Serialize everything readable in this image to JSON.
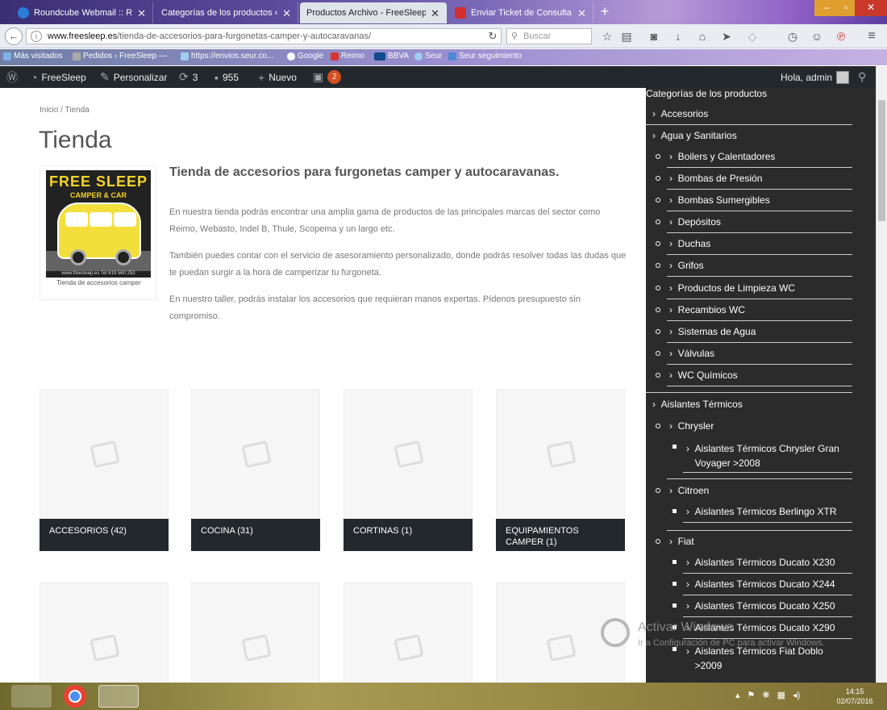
{
  "browser": {
    "tabs": [
      {
        "label": "Roundcube Webmail :: Re...",
        "active": false,
        "icon": "roundcube-icon"
      },
      {
        "label": "Categorías de los productos ‹ ...",
        "active": false,
        "icon": "none"
      },
      {
        "label": "Productos Archivo - FreeSleep",
        "active": true,
        "icon": "none"
      },
      {
        "label": "Enviar Ticket de Consulta ...",
        "active": false,
        "icon": "ticket-icon"
      }
    ],
    "url_host": "www.freesleep.es",
    "url_path": "/tienda-de-accesorios-para-furgonetas-camper-y-autocaravanas/",
    "search_placeholder": "Buscar",
    "bookmarks": [
      "Más visitados",
      "Pedidos ‹ FreeSleep —",
      "https://envios.seur.co...",
      "Google",
      "Reimo",
      "BBVA",
      "Seur",
      "Seur seguimiento"
    ]
  },
  "adminbar": {
    "site_name": "FreeSleep",
    "customize": "Personalizar",
    "updates": "3",
    "comments": "955",
    "new": "Nuevo",
    "plugin_badge": "2",
    "greeting": "Hola, admin"
  },
  "page": {
    "breadcrumb": "Inicio / Tienda",
    "title": "Tienda",
    "logo_text_1": "FREE SLEEP",
    "logo_text_2": "CAMPER & CAR",
    "logo_text_3": "www.freesleep.es     Tel 619 560 253",
    "image_caption": "Tienda de accesorios camper",
    "desc_title": "Tienda de accesorios para furgonetas camper y autocaravanas.",
    "desc_p1": "En nuestra tienda podrás encontrar una amplia gama de productos de las principales marcas del sector como Reimo, Webasto, Indel B, Thule, Scopema y un largo etc.",
    "desc_p2": "También puedes contar con el servicio de asesoramiento personalizado, donde podrás resolver todas las dudas que te puedan surgir a la hora de camperizar tu furgoneta.",
    "desc_p3": "En nuestro taller, podrás instalar los accesorios que requieran manos expertas. Pídenos presupuesto sin compromiso."
  },
  "products": [
    {
      "label": "ACCESORIOS (42)"
    },
    {
      "label": "COCINA (31)"
    },
    {
      "label": "CORTINAS (1)"
    },
    {
      "label": "EQUIPAMIENTOS CAMPER (1)"
    }
  ],
  "sidebar": {
    "title": "Categorías de los productos",
    "items": [
      {
        "label": "Accesorios"
      },
      {
        "label": "Agua y Sanitarios"
      },
      {
        "label": "Boilers y Calentadores"
      },
      {
        "label": "Bombas de Presión"
      },
      {
        "label": "Bombas Sumergibles"
      },
      {
        "label": "Depósitos"
      },
      {
        "label": "Duchas"
      },
      {
        "label": "Grifos"
      },
      {
        "label": "Productos de Limpieza WC"
      },
      {
        "label": "Recambios WC"
      },
      {
        "label": "Sistemas de Agua"
      },
      {
        "label": "Válvulas"
      },
      {
        "label": "WC Químicos"
      },
      {
        "label": "Aislantes Térmicos"
      },
      {
        "label": "Chrysler"
      },
      {
        "label": "Aislantes Térmicos Chrysler Gran Voyager >2008"
      },
      {
        "label": "Citroen"
      },
      {
        "label": "Aislantes Térmicos Berlingo XTR"
      },
      {
        "label": "Fiat"
      },
      {
        "label": "Aislantes Térmicos Ducato X230"
      },
      {
        "label": "Aislantes Térmicos Ducato X244"
      },
      {
        "label": "Aislantes Térmicos Ducato X250"
      },
      {
        "label": "Aislantes Térmicos Ducato X290"
      },
      {
        "label": "Aislantes Térmicos Fiat Doblo >2009"
      }
    ]
  },
  "watermark": {
    "line1": "Activar Windows",
    "line2": "Ir a Configuración de PC para activar Windows."
  },
  "taskbar": {
    "time": "14:15",
    "date": "02/07/2016"
  },
  "colors": {
    "adminbar": "#23282d",
    "sidebar": "#2b2b2b",
    "badge": "#d54e21",
    "logo_yellow": "#f3df3c"
  }
}
